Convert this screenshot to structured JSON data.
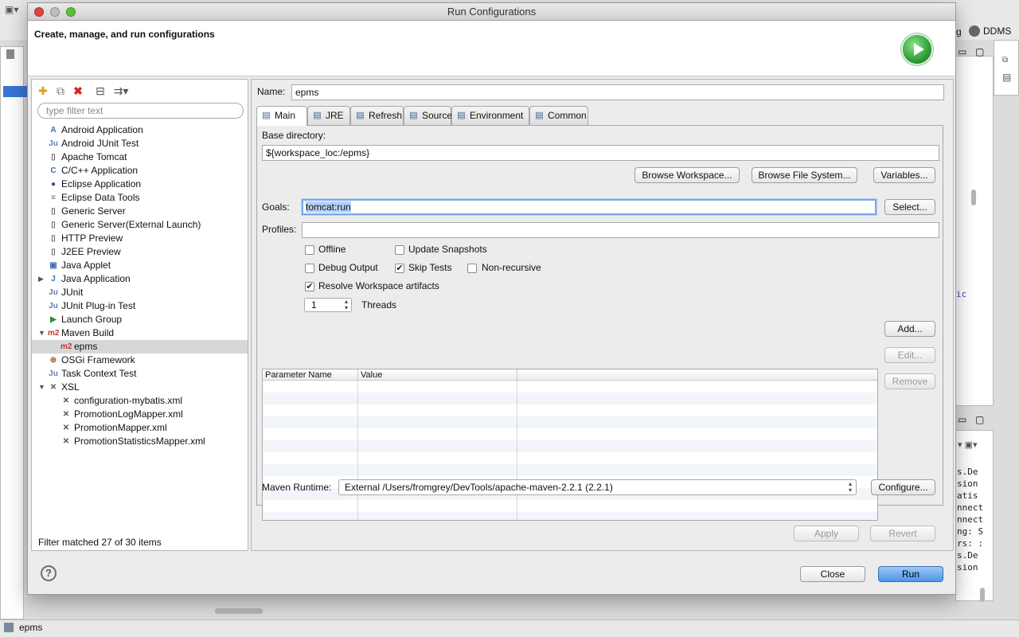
{
  "window": {
    "title": "Run Configurations"
  },
  "header": {
    "title": "Create, manage, and run configurations"
  },
  "background": {
    "perspective_ddms": "DDMS",
    "perspective_prev": "g",
    "statusbar_text": "epms",
    "console_lines": [
      "s.De",
      "sion",
      "",
      "atis",
      "nnect",
      "nnect",
      "ng: S",
      "rs: :",
      "s.De",
      "sion"
    ],
    "editor_fragment": "ic"
  },
  "left": {
    "filter_placeholder": "type filter text",
    "status": "Filter matched 27 of 30 items",
    "items": [
      {
        "label": "Android Application",
        "icon": "android-app-icon",
        "glyph": "A",
        "color": "#3c6fb0"
      },
      {
        "label": "Android JUnit Test",
        "icon": "junit-icon",
        "glyph": "Ju",
        "color": "#5a7fb0"
      },
      {
        "label": "Apache Tomcat",
        "icon": "server-icon",
        "glyph": "▯",
        "color": "#666"
      },
      {
        "label": "C/C++ Application",
        "icon": "c-app-icon",
        "glyph": "C",
        "color": "#3c6fb0"
      },
      {
        "label": "Eclipse Application",
        "icon": "eclipse-icon",
        "glyph": "●",
        "color": "#5b3b8a"
      },
      {
        "label": "Eclipse Data Tools",
        "icon": "database-icon",
        "glyph": "≡",
        "color": "#666"
      },
      {
        "label": "Generic Server",
        "icon": "server-icon",
        "glyph": "▯",
        "color": "#666"
      },
      {
        "label": "Generic Server(External Launch)",
        "icon": "server-icon",
        "glyph": "▯",
        "color": "#666"
      },
      {
        "label": "HTTP Preview",
        "icon": "server-icon",
        "glyph": "▯",
        "color": "#666"
      },
      {
        "label": "J2EE Preview",
        "icon": "server-icon",
        "glyph": "▯",
        "color": "#666"
      },
      {
        "label": "Java Applet",
        "icon": "applet-icon",
        "glyph": "▣",
        "color": "#3c6fb0"
      },
      {
        "label": "Java Application",
        "icon": "java-app-icon",
        "glyph": "J",
        "color": "#3c6fb0",
        "arrow": "▶"
      },
      {
        "label": "JUnit",
        "icon": "junit-icon",
        "glyph": "Ju",
        "color": "#5a7fb0"
      },
      {
        "label": "JUnit Plug-in Test",
        "icon": "junit-icon",
        "glyph": "Ju",
        "color": "#5a7fb0"
      },
      {
        "label": "Launch Group",
        "icon": "launch-group-icon",
        "glyph": "▶",
        "color": "#2f8f3a"
      },
      {
        "label": "Maven Build",
        "icon": "maven-icon",
        "glyph": "m2",
        "color": "#c0392b",
        "arrow": "▼"
      },
      {
        "label": "epms",
        "icon": "maven-icon",
        "glyph": "m2",
        "color": "#c0392b",
        "child": true,
        "selected": true
      },
      {
        "label": "OSGi Framework",
        "icon": "osgi-icon",
        "glyph": "⊕",
        "color": "#b5651d"
      },
      {
        "label": "Task Context Test",
        "icon": "junit-icon",
        "glyph": "Ju",
        "color": "#5a7fb0"
      },
      {
        "label": "XSL",
        "icon": "xsl-icon",
        "glyph": "✕",
        "color": "#555",
        "arrow": "▼"
      },
      {
        "label": "configuration-mybatis.xml",
        "icon": "xsl-icon",
        "glyph": "✕",
        "color": "#555",
        "child": true
      },
      {
        "label": "PromotionLogMapper.xml",
        "icon": "xsl-icon",
        "glyph": "✕",
        "color": "#555",
        "child": true
      },
      {
        "label": "PromotionMapper.xml",
        "icon": "xsl-icon",
        "glyph": "✕",
        "color": "#555",
        "child": true
      },
      {
        "label": "PromotionStatisticsMapper.xml",
        "icon": "xsl-icon",
        "glyph": "✕",
        "color": "#555",
        "child": true
      }
    ]
  },
  "right": {
    "name_label": "Name:",
    "name_value": "epms",
    "tabs": [
      {
        "label": "Main",
        "icon": "main-tab-icon",
        "active": true
      },
      {
        "label": "JRE",
        "icon": "jre-tab-icon"
      },
      {
        "label": "Refresh",
        "icon": "refresh-tab-icon"
      },
      {
        "label": "Source",
        "icon": "source-tab-icon"
      },
      {
        "label": "Environment",
        "icon": "environment-tab-icon"
      },
      {
        "label": "Common",
        "icon": "common-tab-icon"
      }
    ],
    "base_dir_label": "Base directory:",
    "base_dir_value": "${workspace_loc:/epms}",
    "browse_workspace": "Browse Workspace...",
    "browse_fs": "Browse File System...",
    "variables": "Variables...",
    "goals_label": "Goals:",
    "goals_value": "tomcat:run",
    "select": "Select...",
    "profiles_label": "Profiles:",
    "profiles_value": "",
    "checkboxes": {
      "offline": {
        "label": "Offline",
        "checked": false
      },
      "update_snapshots": {
        "label": "Update Snapshots",
        "checked": false
      },
      "debug_output": {
        "label": "Debug Output",
        "checked": false
      },
      "skip_tests": {
        "label": "Skip Tests",
        "checked": true
      },
      "non_recursive": {
        "label": "Non-recursive",
        "checked": false
      },
      "resolve_workspace": {
        "label": "Resolve Workspace artifacts",
        "checked": true
      }
    },
    "threads_value": "1",
    "threads_label": "Threads",
    "params_headers": [
      "Parameter Name",
      "Value"
    ],
    "add": "Add...",
    "edit": "Edit...",
    "remove": "Remove",
    "runtime_label": "Maven Runtime:",
    "runtime_value": "External /Users/fromgrey/DevTools/apache-maven-2.2.1 (2.2.1)",
    "configure": "Configure...",
    "apply": "Apply",
    "revert": "Revert"
  },
  "footer": {
    "help": "?",
    "close": "Close",
    "run": "Run"
  }
}
